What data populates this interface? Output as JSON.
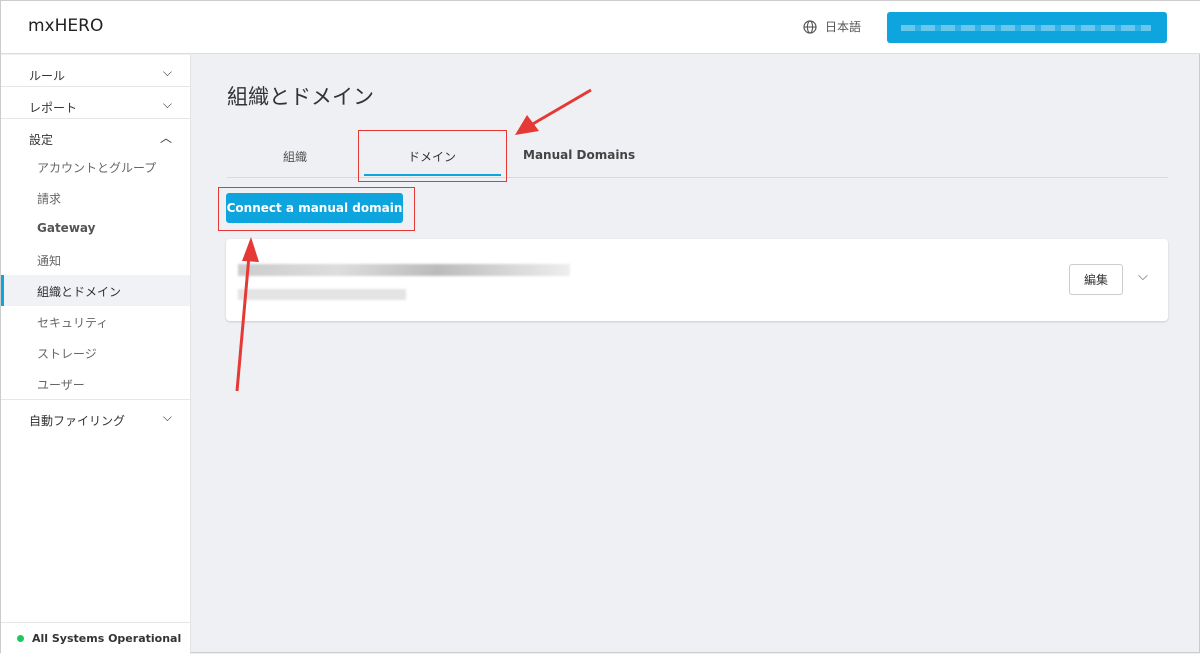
{
  "header": {
    "logo": "mxHERO",
    "language": "日本語"
  },
  "sidebar": {
    "sections": [
      {
        "label": "ルール",
        "expanded": false
      },
      {
        "label": "レポート",
        "expanded": false
      },
      {
        "label": "設定",
        "expanded": true
      },
      {
        "label": "自動ファイリング",
        "expanded": false
      }
    ],
    "settings_items": [
      "アカウントとグループ",
      "請求",
      "Gateway",
      "通知",
      "組織とドメイン",
      "セキュリティ",
      "ストレージ",
      "ユーザー"
    ],
    "active_item": "組織とドメイン",
    "status": "All Systems Operational"
  },
  "main": {
    "title": "組織とドメイン",
    "tabs": [
      "組織",
      "ドメイン",
      "Manual Domains"
    ],
    "active_tab": "ドメイン",
    "connect_button": "Connect a manual domain",
    "card": {
      "edit_button": "編集"
    }
  },
  "colors": {
    "accent": "#0ea5de",
    "annotation": "#e53935",
    "status": "#22c55e"
  }
}
